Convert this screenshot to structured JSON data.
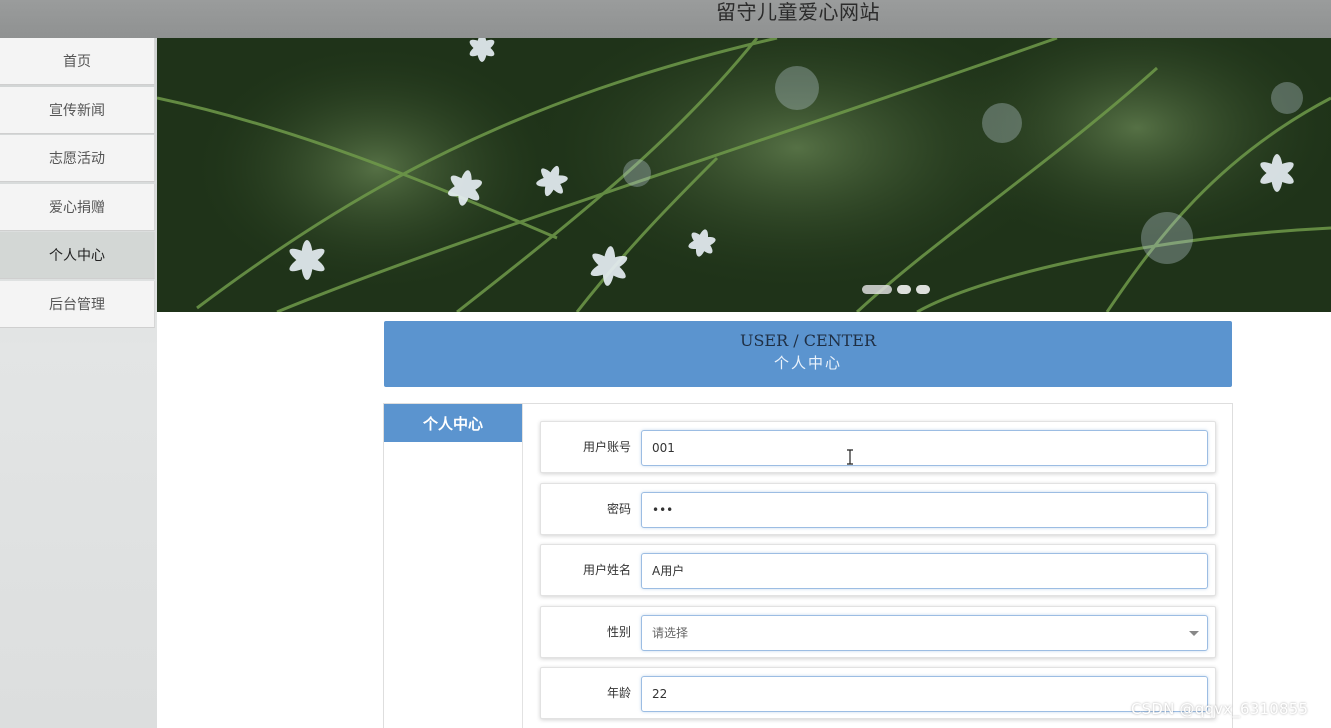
{
  "header": {
    "title": "留守儿童爱心网站"
  },
  "sidebar": {
    "items": [
      {
        "label": "首页",
        "name": "sidebar-item-home"
      },
      {
        "label": "宣传新闻",
        "name": "sidebar-item-news"
      },
      {
        "label": "志愿活动",
        "name": "sidebar-item-volunteer"
      },
      {
        "label": "爱心捐赠",
        "name": "sidebar-item-donation"
      },
      {
        "label": "个人中心",
        "name": "sidebar-item-personal-center",
        "active": true
      },
      {
        "label": "后台管理",
        "name": "sidebar-item-admin"
      }
    ]
  },
  "banner": {
    "slides": 3,
    "active_slide": 1
  },
  "section": {
    "title_en": "USER / CENTER",
    "title_cn": "个人中心"
  },
  "panel": {
    "tab_label": "个人中心"
  },
  "form": {
    "account": {
      "label": "用户账号",
      "value": "001"
    },
    "password": {
      "label": "密码",
      "value": "•••"
    },
    "name": {
      "label": "用户姓名",
      "value": "A用户"
    },
    "gender": {
      "label": "性别",
      "placeholder": "请选择"
    },
    "age": {
      "label": "年龄",
      "value": "22"
    }
  },
  "watermark": "CSDN @qqvx_6310855",
  "colors": {
    "accent": "#5b94cf",
    "header": "#999b9b"
  }
}
